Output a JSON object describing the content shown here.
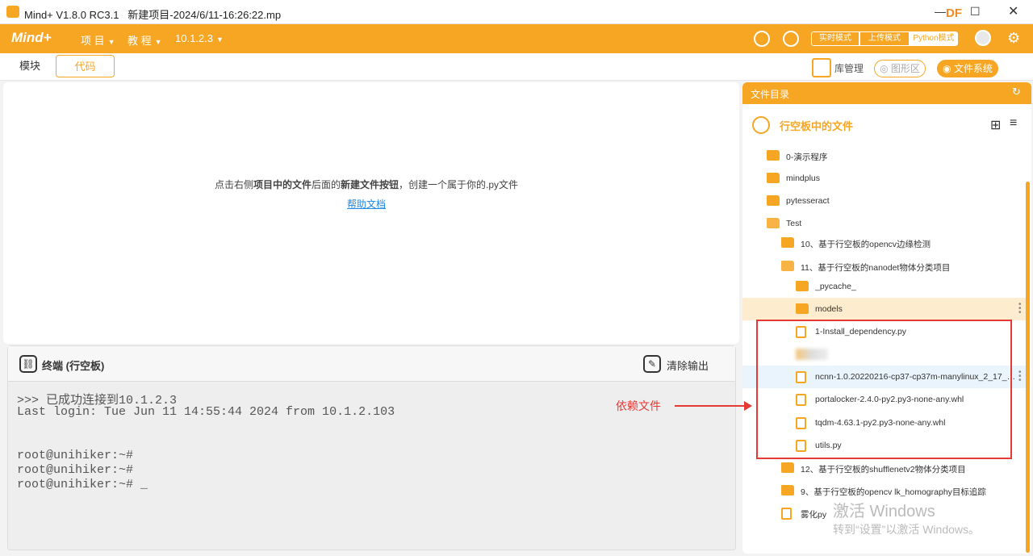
{
  "window": {
    "title": "Mind+ V1.8.0 RC3.1   新建项目-2024/6/11-16:26:22.mp",
    "brand": "DF",
    "minimize_icon": "minimize-icon",
    "maximize_icon": "maximize-icon",
    "close_icon": "close-icon"
  },
  "menubar": {
    "logo": "Mind+",
    "items": [
      {
        "label": "项 目"
      },
      {
        "label": "教 程"
      },
      {
        "label": "10.1.2.3"
      }
    ],
    "modes": {
      "realtime": "实时模式",
      "upload": "上传模式",
      "python": "Python模式"
    }
  },
  "tabs": {
    "blocks": "模块",
    "code": "代码"
  },
  "toolbar": {
    "library": "库管理",
    "graphics": "图形区",
    "filesystem": "文件系统"
  },
  "editor": {
    "hint_pre": "点击右侧",
    "hint_bold1": "项目中的文件",
    "hint_mid": "后面的",
    "hint_bold2": "新建文件按钮",
    "hint_post": "，创建一个属于你的.py文件",
    "help_link": "帮助文档"
  },
  "terminal": {
    "title": "终端 (行空板)",
    "clear_label": "清除输出",
    "lines": [
      ">>> 已成功连接到10.1.2.3",
      "Last login: Tue Jun 11 14:55:44 2024 from 10.1.2.103",
      "",
      "",
      "root@unihiker:~#",
      "root@unihiker:~#",
      "root@unihiker:~# _"
    ]
  },
  "files": {
    "header": "文件目录",
    "section_title": "行空板中的文件",
    "items": [
      {
        "label": "0-演示程序",
        "type": "folder"
      },
      {
        "label": "mindplus",
        "type": "folder"
      },
      {
        "label": "pytesseract",
        "type": "folder"
      },
      {
        "label": "Test",
        "type": "folder-open"
      },
      {
        "label": "10、基于行空板的opencv边缘检测",
        "type": "folder"
      },
      {
        "label": "11、基于行空板的nanodet物体分类项目",
        "type": "folder-open"
      },
      {
        "label": "_pycache_",
        "type": "folder"
      },
      {
        "label": "models",
        "type": "folder"
      },
      {
        "label": "1-Install_dependency.py",
        "type": "file"
      },
      {
        "label": "",
        "type": "blurred"
      },
      {
        "label": "ncnn-1.0.20220216-cp37-cp37m-manylinux_2_17_aa...",
        "type": "file"
      },
      {
        "label": "portalocker-2.4.0-py2.py3-none-any.whl",
        "type": "file"
      },
      {
        "label": "tqdm-4.63.1-py2.py3-none-any.whl",
        "type": "file"
      },
      {
        "label": "utils.py",
        "type": "file"
      },
      {
        "label": "12、基于行空板的shufflenetv2物体分类项目",
        "type": "folder"
      },
      {
        "label": "9、基于行空板的opencv lk_homography目标追踪",
        "type": "folder"
      },
      {
        "label": "雾化py",
        "type": "file"
      }
    ]
  },
  "annotation": {
    "label": "依赖文件"
  },
  "watermark": {
    "line1": "激活 Windows",
    "line2": "转到“设置”以激活 Windows。"
  },
  "colors": {
    "accent": "#f6a623",
    "annotation": "#e53935",
    "link": "#1e88e5"
  }
}
